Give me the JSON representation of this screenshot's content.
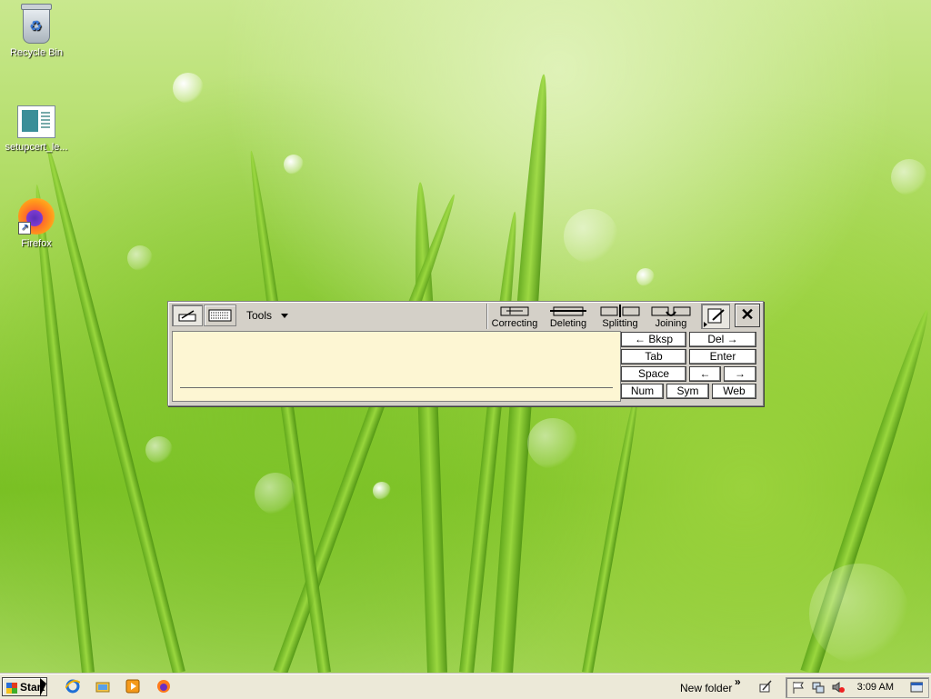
{
  "desktop": {
    "icons": [
      {
        "label": "Recycle Bin",
        "icon": "recycle-bin-icon"
      },
      {
        "label": "setupcert_le...",
        "icon": "document-icon"
      },
      {
        "label": "Firefox",
        "icon": "firefox-icon"
      }
    ]
  },
  "input_panel": {
    "tools_label": "Tools",
    "gestures": [
      "Correcting",
      "Deleting",
      "Splitting",
      "Joining"
    ],
    "close_label": "✕",
    "keys": {
      "bksp": "←   Bksp",
      "del": "Del   →",
      "tab": "Tab",
      "enter": "Enter",
      "space": "Space",
      "left": "←",
      "right": "→",
      "num": "Num",
      "sym": "Sym",
      "web": "Web"
    }
  },
  "taskbar": {
    "start_label": "Start",
    "toolbar_label": "New folder",
    "chevron": "»",
    "clock": "3:09 AM"
  },
  "colors": {
    "writing_pad": "#fdf6d3",
    "panel_face": "#d4d0c8",
    "taskbar": "#ece9d8"
  }
}
